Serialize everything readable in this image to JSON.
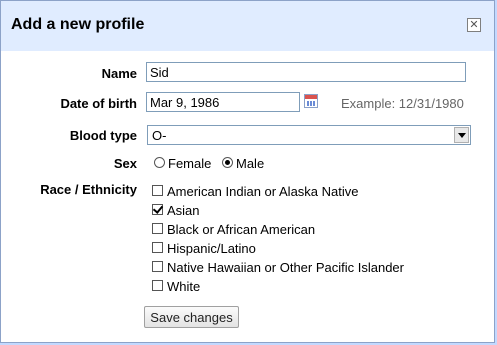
{
  "dialog": {
    "title": "Add a new profile",
    "close_glyph": "✕"
  },
  "form": {
    "name_label": "Name",
    "name_value": "Sid",
    "dob_label": "Date of birth",
    "dob_value": "Mar 9, 1986",
    "dob_example": "Example: 12/31/1980",
    "blood_label": "Blood type",
    "blood_value": "O-",
    "sex_label": "Sex",
    "sex_options": [
      {
        "label": "Female",
        "selected": false
      },
      {
        "label": "Male",
        "selected": true
      }
    ],
    "race_label": "Race / Ethnicity",
    "race_options": [
      {
        "label": "American Indian or Alaska Native",
        "checked": false
      },
      {
        "label": "Asian",
        "checked": true
      },
      {
        "label": "Black or African American",
        "checked": false
      },
      {
        "label": "Hispanic/Latino",
        "checked": false
      },
      {
        "label": "Native Hawaiian or Other Pacific Islander",
        "checked": false
      },
      {
        "label": "White",
        "checked": false
      }
    ],
    "save_label": "Save changes"
  },
  "icons": {
    "close": "close-icon",
    "calendar": "calendar-icon",
    "dropdown": "chevron-down-icon"
  },
  "colors": {
    "titlebar": "#e0ecff",
    "border": "#8ca2c8",
    "example_text": "#666666"
  }
}
